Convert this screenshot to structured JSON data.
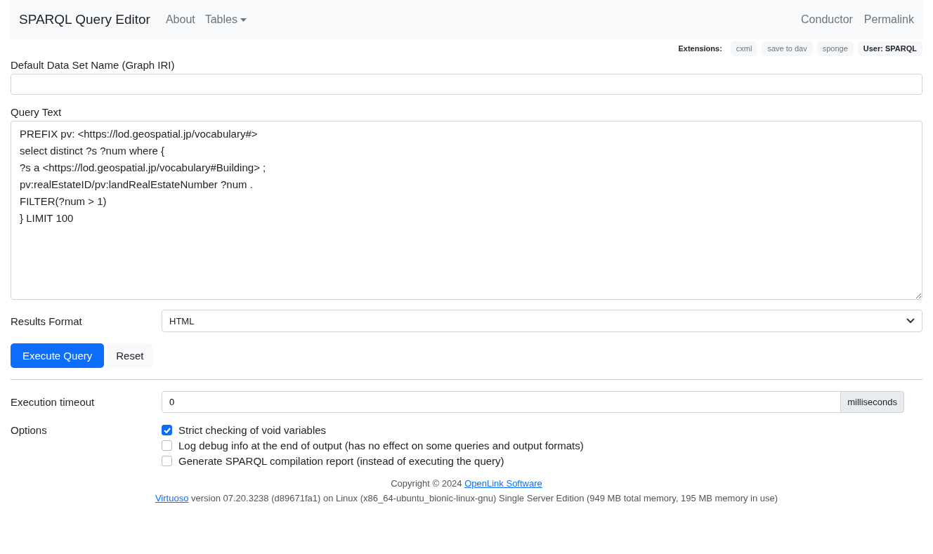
{
  "navbar": {
    "brand": "SPARQL Query Editor",
    "links": [
      {
        "label": "About",
        "kind": "link"
      },
      {
        "label": "Tables",
        "kind": "dropdown"
      }
    ],
    "right_links": [
      "Conductor",
      "Permalink"
    ]
  },
  "extensions": {
    "label": "Extensions:",
    "items": [
      "cxml",
      "save to dav",
      "sponge"
    ],
    "user": "User: SPARQL"
  },
  "graph_field": {
    "label": "Default Data Set Name (Graph IRI)"
  },
  "query": {
    "label": "Query Text",
    "value": "PREFIX pv: <https://lod.geospatial.jp/vocabulary#>\nselect distinct ?s ?num where {\n?s a <https://lod.geospatial.jp/vocabulary#Building> ;\npv:realEstateID/pv:landRealEstateNumber ?num .\nFILTER(?num > 1)\n} LIMIT 100"
  },
  "results_format": {
    "label": "Results Format",
    "value": "HTML"
  },
  "buttons": [
    {
      "label": "Execute Query",
      "kind": "primary"
    },
    {
      "label": "Reset",
      "kind": "secondary"
    }
  ],
  "timeout": {
    "label": "Execution timeout",
    "value": "0",
    "unit": "milliseconds"
  },
  "options": {
    "label": "Options",
    "items": [
      {
        "label": "Strict checking of void variables",
        "checked": true
      },
      {
        "label": "Log debug info at the end of output (has no effect on some queries and output formats)",
        "checked": false
      },
      {
        "label": "Generate SPARQL compilation report (instead of executing the query)",
        "checked": false
      }
    ]
  },
  "footer": {
    "copyright": "Copyright © 2024 ",
    "copyright_link": "OpenLink Software",
    "product_link": "Virtuoso",
    "version": " version 07.20.3238 (d89671fa1) on Linux (x86_64-ubuntu_bionic-linux-gnu) Single Server Edition (949 MB total memory, 195 MB memory in use)"
  }
}
